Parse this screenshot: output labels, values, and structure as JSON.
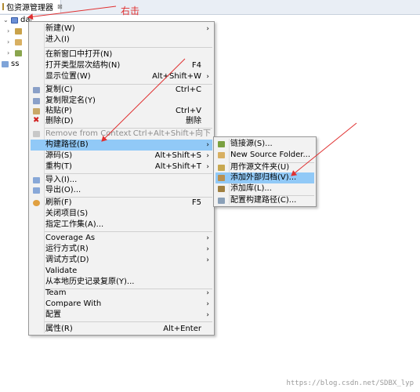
{
  "tab": {
    "title": "包资源管理器",
    "close_glyph": "⊠"
  },
  "tree": [
    {
      "label": "datacases",
      "icon": "project-icon",
      "expanded": true
    },
    {
      "label": "",
      "icon": "jar-icon"
    },
    {
      "label": "",
      "icon": "package-icon"
    },
    {
      "label": "",
      "icon": "source-folder-icon"
    },
    {
      "label": "ss",
      "icon": "server-icon"
    }
  ],
  "annotation": {
    "text": "右击",
    "color": "#e03030"
  },
  "context_menu": {
    "items": [
      {
        "label": "新建(W)",
        "shortcut": "",
        "submenu": true
      },
      {
        "label": "进入(I)",
        "shortcut": ""
      },
      {
        "label": "在新窗口中打开(N)",
        "shortcut": ""
      },
      {
        "label": "打开类型层次结构(N)",
        "shortcut": "F4"
      },
      {
        "label": "显示位置(W)",
        "shortcut": "Alt+Shift+W",
        "submenu": true
      },
      {
        "label": "复制(C)",
        "shortcut": "Ctrl+C",
        "icon": "copy-icon"
      },
      {
        "label": "复制限定名(Y)",
        "shortcut": "",
        "icon": "copy-qualified-icon"
      },
      {
        "label": "粘贴(P)",
        "shortcut": "Ctrl+V",
        "icon": "paste-icon"
      },
      {
        "label": "删除(D)",
        "shortcut": "删除",
        "icon": "delete-icon"
      },
      {
        "label": "Remove from Context",
        "shortcut": "Ctrl+Alt+Shift+向下",
        "disabled": true
      },
      {
        "label": "构建路径(B)",
        "shortcut": "",
        "submenu": true,
        "highlighted": true
      },
      {
        "label": "源码(S)",
        "shortcut": "Alt+Shift+S",
        "submenu": true
      },
      {
        "label": "重构(T)",
        "shortcut": "Alt+Shift+T",
        "submenu": true
      },
      {
        "label": "导入(I)...",
        "shortcut": "",
        "icon": "import-icon"
      },
      {
        "label": "导出(O)...",
        "shortcut": "",
        "icon": "export-icon"
      },
      {
        "label": "刷新(F)",
        "shortcut": "F5",
        "icon": "refresh-icon"
      },
      {
        "label": "关闭项目(S)",
        "shortcut": ""
      },
      {
        "label": "指定工作集(A)...",
        "shortcut": ""
      },
      {
        "label": "Coverage As",
        "shortcut": "",
        "submenu": true
      },
      {
        "label": "运行方式(R)",
        "shortcut": "",
        "submenu": true
      },
      {
        "label": "调试方式(D)",
        "shortcut": "",
        "submenu": true
      },
      {
        "label": "Validate",
        "shortcut": ""
      },
      {
        "label": "从本地历史记录复原(Y)...",
        "shortcut": ""
      },
      {
        "label": "Team",
        "shortcut": "",
        "submenu": true
      },
      {
        "label": "Compare With",
        "shortcut": "",
        "submenu": true
      },
      {
        "label": "配置",
        "shortcut": "",
        "submenu": true
      },
      {
        "label": "属性(R)",
        "shortcut": "Alt+Enter"
      }
    ],
    "arrow_glyph": "›"
  },
  "build_path_submenu": {
    "items": [
      {
        "label": "链接源(S)...",
        "icon": "link-source-icon"
      },
      {
        "label": "New Source Folder...",
        "icon": "new-source-folder-icon"
      },
      {
        "label": "用作源文件夹(U)",
        "icon": "use-as-source-icon"
      },
      {
        "label": "添加外部归档(V)...",
        "icon": "external-archive-icon",
        "highlighted": true
      },
      {
        "label": "添加库(L)...",
        "icon": "add-library-icon"
      },
      {
        "label": "配置构建路径(C)...",
        "icon": "configure-build-path-icon"
      }
    ]
  },
  "watermark": "https://blog.csdn.net/SDBX_lyp",
  "colors": {
    "highlight": "#91c9f7",
    "menu_bg": "#f2f2f2",
    "arrow": "#e03030"
  }
}
